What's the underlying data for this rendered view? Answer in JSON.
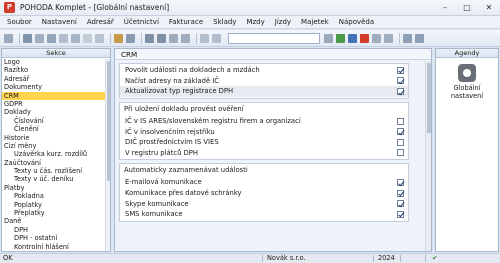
{
  "window": {
    "title": "POHODA Komplet - [Globální nastavení]",
    "app_icon_letter": "P",
    "controls": [
      "–",
      "□",
      "✕"
    ]
  },
  "menu": [
    "Soubor",
    "Nastavení",
    "Adresář",
    "Účetnictví",
    "Fakturace",
    "Sklady",
    "Mzdy",
    "Jízdy",
    "Majetek",
    "Nápověda"
  ],
  "sekce": {
    "title": "Sekce",
    "items": [
      {
        "label": "Logo",
        "level": 0
      },
      {
        "label": "Razítko",
        "level": 0
      },
      {
        "label": "Adresář",
        "level": 0
      },
      {
        "label": "Dokumenty",
        "level": 0
      },
      {
        "label": "CRM",
        "level": 0,
        "selected": true
      },
      {
        "label": "GDPR",
        "level": 0
      },
      {
        "label": "Doklady",
        "level": 0
      },
      {
        "label": "Číslování",
        "level": 1
      },
      {
        "label": "Členění",
        "level": 1
      },
      {
        "label": "Historie",
        "level": 0
      },
      {
        "label": "Cizí měny",
        "level": 0
      },
      {
        "label": "Uzávěrka kurz. rozdílů",
        "level": 1
      },
      {
        "label": "Zaúčtování",
        "level": 0
      },
      {
        "label": "Texty u čás. rozlišení",
        "level": 1
      },
      {
        "label": "Texty v úč. deníku",
        "level": 1
      },
      {
        "label": "Platby",
        "level": 0
      },
      {
        "label": "Pokladna",
        "level": 1
      },
      {
        "label": "Poplatky",
        "level": 1
      },
      {
        "label": "Přeplatky",
        "level": 1
      },
      {
        "label": "Daně",
        "level": 0
      },
      {
        "label": "DPH",
        "level": 1
      },
      {
        "label": "DPH - ostatní",
        "level": 1
      },
      {
        "label": "Kontrolní hlášení",
        "level": 1
      }
    ]
  },
  "main": {
    "title": "CRM",
    "groups": [
      {
        "title": "",
        "rows": [
          {
            "label": "Povolit události na dokladech a mzdách",
            "checked": true,
            "highlight": false
          },
          {
            "label": "Načíst adresy na základě IČ",
            "checked": true,
            "highlight": false
          },
          {
            "label": "Aktualizovat typ registrace DPH",
            "checked": true,
            "highlight": true
          }
        ]
      },
      {
        "title": "Při uložení dokladu provést ověření",
        "rows": [
          {
            "label": "IČ v IS ARES/slovenském registru firem a organizací",
            "checked": false,
            "highlight": false
          },
          {
            "label": "IČ v insolvenčním rejstříku",
            "checked": true,
            "highlight": false
          },
          {
            "label": "DIČ prostřednictvím IS VIES",
            "checked": false,
            "highlight": false
          },
          {
            "label": "V registru plátců DPH",
            "checked": false,
            "highlight": false
          }
        ]
      },
      {
        "title": "Automaticky zaznamenávat události",
        "rows": [
          {
            "label": "E-mailová komunikace",
            "checked": true,
            "highlight": false
          },
          {
            "label": "Komunikace přes datové schránky",
            "checked": true,
            "highlight": false
          },
          {
            "label": "Skype komunikace",
            "checked": true,
            "highlight": false
          },
          {
            "label": "SMS komunikace",
            "checked": true,
            "highlight": false
          }
        ]
      }
    ]
  },
  "agendy": {
    "title": "Agendy",
    "tile_label": "Globální nastavení",
    "tile_icon": "gear-icon"
  },
  "status": {
    "left": "OK",
    "company": "Novák s.r.o.",
    "year": "2024",
    "check_mark": "✔"
  },
  "colors": {
    "selected_bg": "#ffd451",
    "accent_blue": "#1f3e6e",
    "app_red": "#d23a2a"
  }
}
